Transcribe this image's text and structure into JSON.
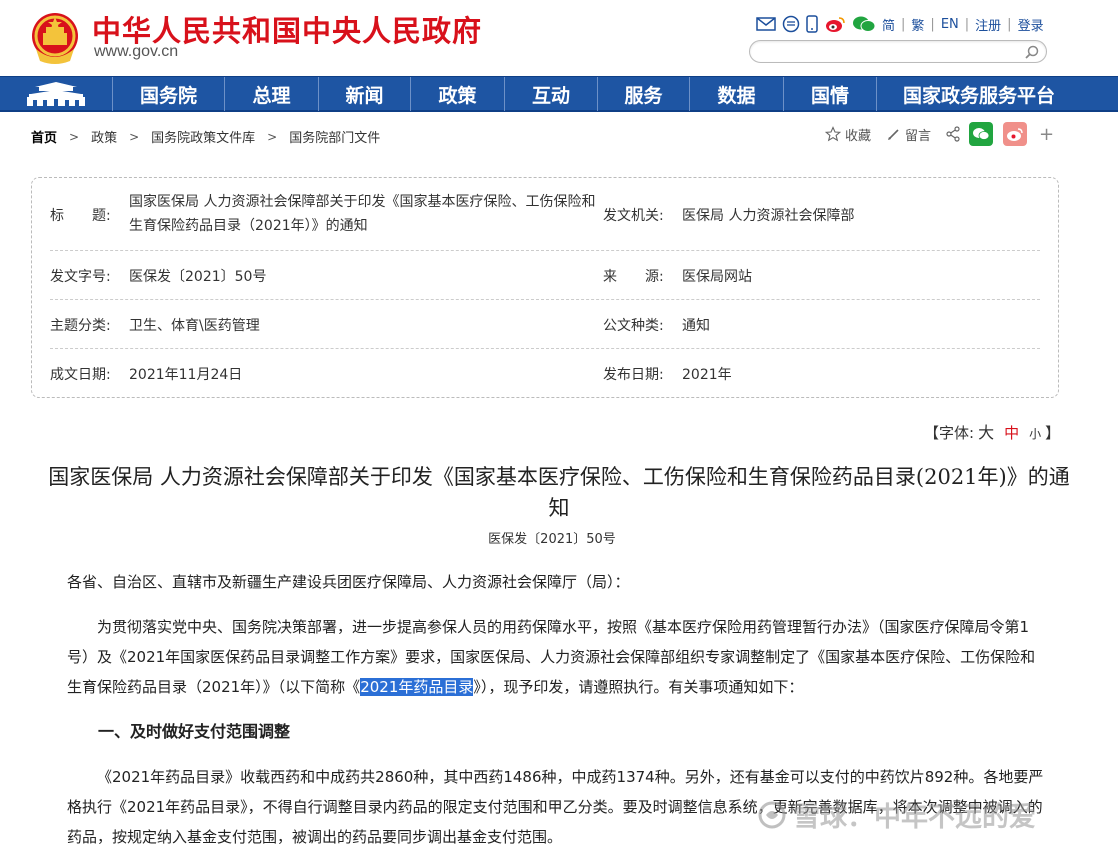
{
  "header": {
    "site_title": "中华人民共和国中央人民政府",
    "site_url": "www.gov.cn",
    "toplinks": {
      "simplified": "简",
      "traditional": "繁",
      "english": "EN",
      "register": "注册",
      "login": "登录"
    },
    "icons": [
      "mail-icon",
      "chat-icon",
      "phone-icon",
      "weibo-icon",
      "wechat-icon"
    ],
    "search": {
      "placeholder": "",
      "value": ""
    }
  },
  "nav": {
    "items": [
      {
        "label": "国务院"
      },
      {
        "label": "总理"
      },
      {
        "label": "新闻"
      },
      {
        "label": "政策"
      },
      {
        "label": "互动"
      },
      {
        "label": "服务"
      },
      {
        "label": "数据"
      },
      {
        "label": "国情"
      },
      {
        "label": "国家政务服务平台"
      }
    ]
  },
  "breadcrumb": [
    "首页",
    "政策",
    "国务院政策文件库",
    "国务院部门文件"
  ],
  "tools": {
    "favorite": "收藏",
    "comment": "留言"
  },
  "info": {
    "title_label": "标　　题:",
    "title_value": "国家医保局 人力资源社会保障部关于印发《国家基本医疗保险、工伤保险和生育保险药品目录（2021年）》的通知",
    "issuer_label": "发文机关:",
    "issuer_value": "医保局 人力资源社会保障部",
    "docno_label": "发文字号:",
    "docno_value": "医保发〔2021〕50号",
    "source_label": "来　　源:",
    "source_value": "医保局网站",
    "topic_label": "主题分类:",
    "topic_value": "卫生、体育\\医药管理",
    "type_label": "公文种类:",
    "type_value": "通知",
    "created_label": "成文日期:",
    "created_value": "2021年11月24日",
    "published_label": "发布日期:",
    "published_value": "2021年"
  },
  "fontsize": {
    "open": "【字体:",
    "big": "大",
    "mid": "中",
    "small": "小",
    "close": "】"
  },
  "article": {
    "title": "国家医保局 人力资源社会保障部关于印发《国家基本医疗保险、工伤保险和生育保险药品目录(2021年)》的通知",
    "doc_no": "医保发〔2021〕50号",
    "greeting": "各省、自治区、直辖市及新疆生产建设兵团医疗保障局、人力资源社会保障厅（局）：",
    "p1_before": "为贯彻落实党中央、国务院决策部署，进一步提高参保人员的用药保障水平，按照《基本医疗保险用药管理暂行办法》（国家医疗保障局令第1号）及《2021年国家医保药品目录调整工作方案》要求，国家医保局、人力资源社会保障部组织专家调整制定了《国家基本医疗保险、工伤保险和生育保险药品目录（2021年）》（以下简称《",
    "p1_highlight": "2021年药品目录",
    "p1_after": "》），现予印发，请遵照执行。有关事项通知如下：",
    "section1": "一、及时做好支付范围调整",
    "p2": "《2021年药品目录》收载西药和中成药共2860种，其中西药1486种，中成药1374种。另外，还有基金可以支付的中药饮片892种。各地要严格执行《2021年药品目录》，不得自行调整目录内药品的限定支付范围和甲乙分类。要及时调整信息系统，更新完善数据库，将本次调整中被调入的药品，按规定纳入基金支付范围，被调出的药品要同步调出基金支付范围。"
  },
  "watermark": {
    "text": "雪球：中年不远的爱"
  }
}
